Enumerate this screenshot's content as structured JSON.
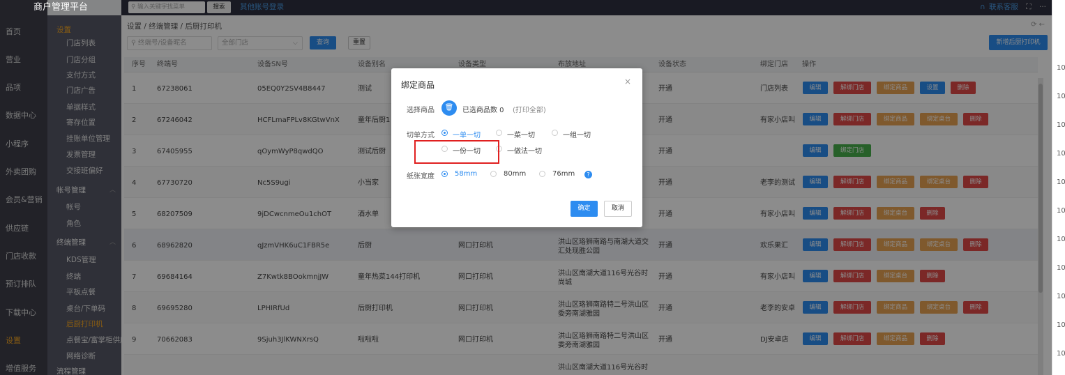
{
  "app": {
    "brand": "商户管理平台"
  },
  "topbar": {
    "search_placeholder": "输入关键字找菜单",
    "search_button": "搜索",
    "other_login": "其他账号登录",
    "contact": "联系客服",
    "fullscreen_icon": "⛶",
    "more_icon": "···"
  },
  "rail": {
    "items": [
      "首页",
      "营业",
      "品项",
      "数据中心",
      "小程序",
      "外卖团购",
      "会员&营销",
      "供应链",
      "门店收款",
      "预订排队",
      "下载中心",
      "设置",
      "增值服务"
    ],
    "active": "设置"
  },
  "subnav": {
    "items": [
      {
        "label": "设置",
        "type": "group-orange"
      },
      {
        "label": "门店列表",
        "type": "item"
      },
      {
        "label": "门店分组",
        "type": "item"
      },
      {
        "label": "支付方式",
        "type": "item"
      },
      {
        "label": "门店广告",
        "type": "item"
      },
      {
        "label": "单据样式",
        "type": "item"
      },
      {
        "label": "寄存位置",
        "type": "item"
      },
      {
        "label": "挂账单位管理",
        "type": "item"
      },
      {
        "label": "发票管理",
        "type": "item"
      },
      {
        "label": "交接班偏好",
        "type": "item"
      },
      {
        "label": "帐号管理",
        "type": "group"
      },
      {
        "label": "帐号",
        "type": "item"
      },
      {
        "label": "角色",
        "type": "item"
      },
      {
        "label": "终端管理",
        "type": "group"
      },
      {
        "label": "KDS管理",
        "type": "item"
      },
      {
        "label": "终端",
        "type": "item"
      },
      {
        "label": "平板点餐",
        "type": "item"
      },
      {
        "label": "桌台/下单码",
        "type": "item"
      },
      {
        "label": "后厨打印机",
        "type": "active"
      },
      {
        "label": "点餐宝/富掌柜供应",
        "type": "item"
      },
      {
        "label": "网络诊断",
        "type": "item"
      },
      {
        "label": "流程管理",
        "type": "group"
      }
    ]
  },
  "breadcrumb": "设置 / 终端管理 / 后厨打印机",
  "filters": {
    "terminal_placeholder": "终端号/设备昵名",
    "store_select": "全部门店",
    "query": "查询",
    "reset": "重置",
    "add": "新增后厨打印机"
  },
  "table": {
    "headers": [
      "序号",
      "终端号",
      "设备SN号",
      "设备别名",
      "设备类型",
      "布放地址",
      "设备状态",
      "绑定门店",
      "操作"
    ],
    "rows": [
      {
        "no": "1",
        "terminal": "67238061",
        "sn": "05EQ0Y2SV4B8447",
        "alias": "测试",
        "type": "",
        "addr": "",
        "status": "开通",
        "store": "门店列表",
        "ops": [
          [
            "编辑",
            "blue"
          ],
          [
            "解绑门店",
            "red"
          ],
          [
            "绑定商品",
            "orange"
          ],
          [
            "设置",
            "blue"
          ],
          [
            "删除",
            "red"
          ]
        ]
      },
      {
        "no": "2",
        "terminal": "67246042",
        "sn": "HCFLmaFPLv8KGtwVnX",
        "alias": "童年后厨1",
        "type": "",
        "addr": "",
        "status": "开通",
        "store": "有家小店叫",
        "ops": [
          [
            "编辑",
            "blue"
          ],
          [
            "解绑门店",
            "red"
          ],
          [
            "绑定商品",
            "orange"
          ],
          [
            "绑定桌台",
            "orange"
          ],
          [
            "删除",
            "red"
          ]
        ]
      },
      {
        "no": "3",
        "terminal": "67405955",
        "sn": "qOymWyP8qwdQO",
        "alias": "测试后厨",
        "type": "",
        "addr": "",
        "status": "开通",
        "store": "",
        "ops": [
          [
            "编辑",
            "blue"
          ],
          [
            "绑定门店",
            "green"
          ]
        ]
      },
      {
        "no": "4",
        "terminal": "67730720",
        "sn": "Nc5S9ugi",
        "alias": "小当家",
        "type": "",
        "addr": "",
        "status": "开通",
        "store": "老李的测试",
        "ops": [
          [
            "编辑",
            "blue"
          ],
          [
            "解绑门店",
            "red"
          ],
          [
            "绑定商品",
            "orange"
          ],
          [
            "绑定桌台",
            "orange"
          ],
          [
            "删除",
            "red"
          ]
        ]
      },
      {
        "no": "5",
        "terminal": "68207509",
        "sn": "9jDCwcnmeOu1chOT",
        "alias": "酒水单",
        "type": "",
        "addr": "",
        "status": "开通",
        "store": "有家小店叫",
        "ops": [
          [
            "编辑",
            "blue"
          ],
          [
            "解绑门店",
            "red"
          ],
          [
            "绑定桌台",
            "orange"
          ],
          [
            "删除",
            "red"
          ]
        ]
      },
      {
        "no": "6",
        "terminal": "68962820",
        "sn": "qJzmVHK6uC1FBR5e",
        "alias": "后厨",
        "type": "网口打印机",
        "addr": "洪山区珞狮南路与南湖大道交汇处现胜公园",
        "status": "开通",
        "store": "欢乐果汇",
        "ops": [
          [
            "编辑",
            "blue"
          ],
          [
            "解绑门店",
            "red"
          ],
          [
            "绑定商品",
            "orange"
          ],
          [
            "绑定桌台",
            "orange"
          ],
          [
            "删除",
            "red"
          ]
        ]
      },
      {
        "no": "7",
        "terminal": "69684164",
        "sn": "Z7Kwtk8BOokmnjJW",
        "alias": "童年热菜144打印机",
        "type": "网口打印机",
        "addr": "洪山区南湖大道116号光谷时尚城",
        "status": "开通",
        "store": "有家小店叫",
        "ops": [
          [
            "编辑",
            "blue"
          ],
          [
            "解绑门店",
            "red"
          ],
          [
            "绑定桌台",
            "orange"
          ],
          [
            "删除",
            "red"
          ]
        ]
      },
      {
        "no": "8",
        "terminal": "69695280",
        "sn": "LPHIRfUd",
        "alias": "后厨打印机",
        "type": "网口打印机",
        "addr": "洪山区珞狮南路特二号洪山区委旁南湖雅园",
        "status": "开通",
        "store": "老李的安卓",
        "ops": [
          [
            "编辑",
            "blue"
          ],
          [
            "解绑门店",
            "red"
          ],
          [
            "绑定商品",
            "orange"
          ],
          [
            "绑定桌台",
            "orange"
          ],
          [
            "删除",
            "red"
          ]
        ]
      },
      {
        "no": "9",
        "terminal": "70662083",
        "sn": "9Sjuh3JlKWNXrsQ",
        "alias": "啦啦啦",
        "type": "网口打印机",
        "addr": "洪山区珞狮南路特二号洪山区委旁南湖雅园",
        "status": "开通",
        "store": "DJ安卓店",
        "ops": [
          [
            "编辑",
            "blue"
          ],
          [
            "解绑门店",
            "red"
          ],
          [
            "绑定商品",
            "orange"
          ],
          [
            "删除",
            "red"
          ]
        ]
      },
      {
        "no": "",
        "terminal": "",
        "sn": "",
        "alias": "",
        "type": "",
        "addr": "洪山区南湖大道116号光谷时",
        "status": "",
        "store": "",
        "ops": []
      }
    ]
  },
  "right_strip": [
    "10",
    "10",
    "10",
    "10",
    "10",
    "10",
    "10",
    "10",
    "10",
    "10",
    "10"
  ],
  "modal": {
    "title": "绑定商品",
    "close": "×",
    "select_label": "选择商品",
    "selected_count": "已选商品数 0",
    "print_all": "(打印全部)",
    "cut_label": "切单方式",
    "cut_options": [
      "一单一切",
      "一菜一切",
      "一组一切",
      "一份一切",
      "一做法一切"
    ],
    "cut_selected": "一单一切",
    "paper_label": "纸张宽度",
    "paper_options": [
      "58mm",
      "80mm",
      "76mm"
    ],
    "paper_selected": "58mm",
    "ok": "确定",
    "cancel": "取消"
  }
}
